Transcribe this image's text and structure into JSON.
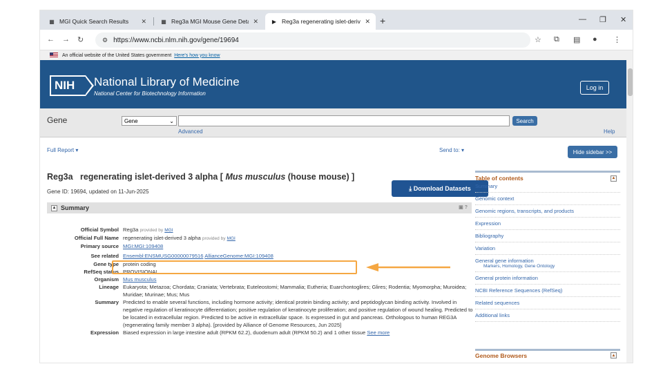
{
  "tabs": [
    {
      "label": "MGI Quick Search Results",
      "active": false
    },
    {
      "label": "Reg3a MGI Mouse Gene Detail",
      "active": false
    },
    {
      "label": "Reg3a regenerating islet-derive",
      "active": true
    }
  ],
  "address_bar": {
    "url": "https://www.ncbi.nlm.nih.gov/gene/19694"
  },
  "gov_banner": {
    "text": "An official website of the United States government",
    "link": "Here's how you know"
  },
  "header": {
    "logo": "NIH",
    "title": "National Library of Medicine",
    "subtitle": "National Center for Biotechnology Information",
    "login_label": "Log in"
  },
  "search": {
    "db_label": "Gene",
    "db_selected": "Gene",
    "search_label": "Search",
    "advanced_label": "Advanced",
    "help_label": "Help"
  },
  "report": {
    "full_report": "Full Report",
    "send_to": "Send to:",
    "hide_sidebar": "Hide sidebar >>"
  },
  "gene": {
    "symbol": "Reg3a",
    "name": "regenerating islet-derived 3 alpha [",
    "organism": "Mus musculus",
    "organism_suffix": "(house mouse) ]",
    "id_line": "Gene ID: 19694, updated on 11-Jun-2025",
    "download_label": "Download Datasets"
  },
  "summary_header": "Summary",
  "details": {
    "official_symbol": {
      "label": "Official Symbol",
      "value": "Reg3a",
      "provided": "provided by",
      "provider": "MGI"
    },
    "official_full_name": {
      "label": "Official Full Name",
      "value": "regenerating islet-derived 3 alpha",
      "provided": "provided by",
      "provider": "MGI"
    },
    "primary_source": {
      "label": "Primary source",
      "value": "MGI:MGI:109408"
    },
    "see_related": {
      "label": "See related",
      "link1": "Ensembl:ENSMUSG00000079516",
      "link2": "AllianceGenome:MGI:109408"
    },
    "gene_type": {
      "label": "Gene type",
      "value": "protein coding"
    },
    "refseq_status": {
      "label": "RefSeq status",
      "value": "PROVISIONAL"
    },
    "organism": {
      "label": "Organism",
      "value": "Mus musculus"
    },
    "lineage": {
      "label": "Lineage",
      "value": "Eukaryota; Metazoa; Chordata; Craniata; Vertebrata; Euteleostomi; Mammalia; Eutheria; Euarchontoglires; Glires; Rodentia; Myomorpha; Muroidea; Muridae; Murinae; Mus; Mus"
    },
    "summary": {
      "label": "Summary",
      "value": "Predicted to enable several functions, including hormone activity; identical protein binding activity; and peptidoglycan binding activity. Involved in negative regulation of keratinocyte differentiation; positive regulation of keratinocyte proliferation; and positive regulation of wound healing. Predicted to be located in extracellular region. Predicted to be active in extracellular space. Is expressed in gut and pancreas. Orthologous to human REG3A (regenerating family member 3 alpha). [provided by Alliance of Genome Resources, Jun 2025]"
    },
    "expression": {
      "label": "Expression",
      "value": "Biased expression in large intestine adult (RPKM 62.2), duodenum adult (RPKM 50.2) and 1 other tissue",
      "link": "See more"
    }
  },
  "sidebar": {
    "toc_title": "Table of contents",
    "items": [
      "Summary",
      "Genomic context",
      "Genomic regions, transcripts, and products",
      "Expression",
      "Bibliography",
      "Variation",
      "General gene information",
      "General protein information",
      "NCBI Reference Sequences (RefSeq)",
      "Related sequences",
      "Additional links"
    ],
    "general_sub": "Markers, Homology, Gene Ontology",
    "genome_title": "Genome Browsers"
  },
  "colors": {
    "nlm_blue": "#20558a",
    "highlight": "#f5a742",
    "link": "#3366aa"
  }
}
